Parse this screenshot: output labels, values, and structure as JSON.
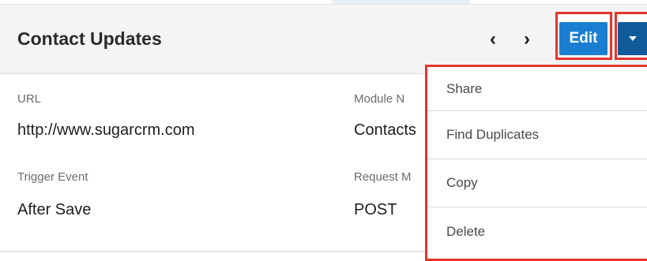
{
  "header": {
    "title": "Contact Updates",
    "prev_label": "‹",
    "next_label": "›",
    "edit_label": "Edit"
  },
  "fields": [
    {
      "label": "URL",
      "value": "http://www.sugarcrm.com"
    },
    {
      "label": "Module N",
      "value": "Contacts"
    },
    {
      "label": "Trigger Event",
      "value": "After Save"
    },
    {
      "label": "Request M",
      "value": "POST"
    }
  ],
  "menu": {
    "items": [
      {
        "label": "Share"
      },
      {
        "label": "Find Duplicates"
      },
      {
        "label": "Copy"
      },
      {
        "label": "Delete"
      }
    ]
  },
  "colors": {
    "primary_button": "#1a7fd1",
    "dropdown_button": "#0f5a99",
    "highlight": "#e4352a",
    "header_bg": "#f4f4f4"
  }
}
